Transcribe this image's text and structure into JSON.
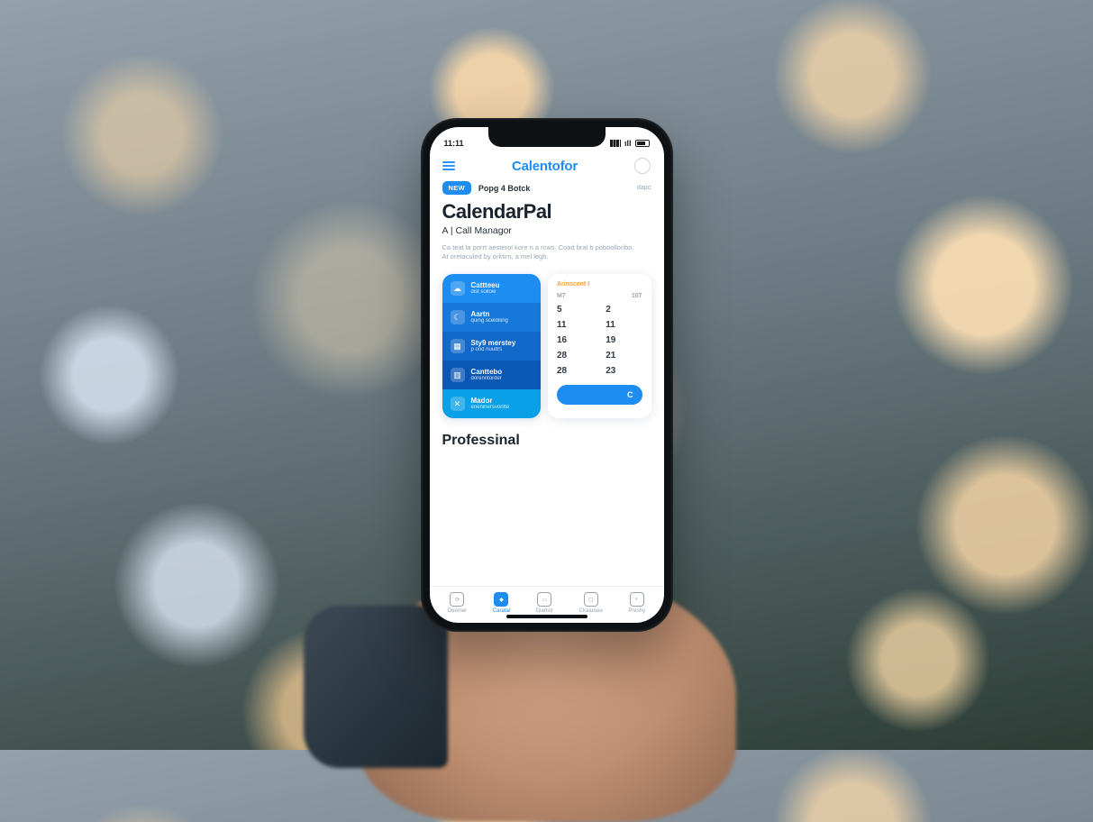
{
  "colors": {
    "accent": "#1d8df2"
  },
  "status": {
    "time": "11:11",
    "carrier": "ıll",
    "battery_pct": 70
  },
  "navbar": {
    "brand": "Calentofor"
  },
  "pill": {
    "badge": "NEW",
    "text": "Popg 4 Botck",
    "side": "dapo"
  },
  "hero": {
    "title": "CalendarPal",
    "subtitle": "A | Call Managor",
    "description": "Ca teat la porrt aesterol kore n a rcws. Coad bral b poboolloribo. At oretaculed by orktirn, a mel legh."
  },
  "features": {
    "items": [
      {
        "title": "Cattteeu",
        "sub": "dist   sollow"
      },
      {
        "title": "Aartn",
        "sub": "quing scelditing"
      },
      {
        "title": "Sty9 merstey",
        "sub": "p ond nuultrs"
      },
      {
        "title": "Canttebo",
        "sub": "dorenntorder"
      },
      {
        "title": "Mador",
        "sub": "eneninersvoritte"
      }
    ]
  },
  "calendar": {
    "month_label": "Arinscent I",
    "day_labels": [
      "M7",
      "107"
    ],
    "cells": [
      "5",
      "2",
      "11",
      "11",
      "16",
      "19",
      "28",
      "21",
      "28",
      "23"
    ],
    "button_label": "C"
  },
  "section": {
    "title": "Professinal"
  },
  "tabs": {
    "items": [
      {
        "label": "Deemer"
      },
      {
        "label": "Caratal"
      },
      {
        "label": "Diamor"
      },
      {
        "label": "Ckaaroee"
      },
      {
        "label": "Preshy"
      }
    ],
    "active_index": 1
  }
}
